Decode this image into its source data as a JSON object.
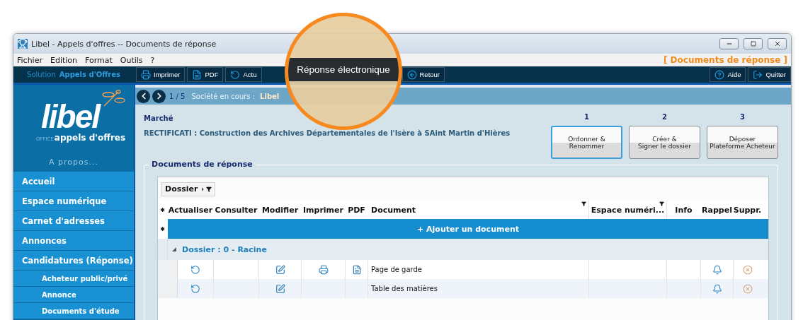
{
  "window": {
    "title": "Libel - Appels d'offres -- Documents de réponse"
  },
  "menu": [
    "Fichier",
    "Edition",
    "Format",
    "Outils",
    "?"
  ],
  "context_label": "[ Documents de réponse ]",
  "toolbar": {
    "solution_label": "Solution",
    "solution_name": "Appels d'Offres",
    "left_buttons": [
      {
        "kind": "print",
        "label": "Imprimer"
      },
      {
        "kind": "pdf",
        "label": "PDF"
      },
      {
        "kind": "refresh",
        "label": "Actu"
      }
    ],
    "middle_buttons": [
      {
        "kind": "back",
        "label": "Retour"
      }
    ],
    "right_buttons": [
      {
        "kind": "help",
        "label": "Aide"
      },
      {
        "kind": "quit",
        "label": "Quitter"
      }
    ]
  },
  "callout": "Réponse électronique",
  "logo": {
    "word": "libel",
    "office": "OFFICE",
    "product": "appels d'offres"
  },
  "about": "A propos...",
  "sidebar": [
    {
      "kind": "main",
      "label": "Accueil"
    },
    {
      "kind": "main",
      "label": "Espace numérique"
    },
    {
      "kind": "main",
      "label": "Carnet d'adresses"
    },
    {
      "kind": "main",
      "label": "Annonces"
    },
    {
      "kind": "main",
      "label": "Candidatures  (Réponse)"
    },
    {
      "kind": "sub",
      "label": "Acheteur public/privé"
    },
    {
      "kind": "sub",
      "label": "Annonce"
    },
    {
      "kind": "sub",
      "label": "Documents d'étude"
    }
  ],
  "nav": {
    "page": "1 / 5",
    "company_label": "Société en cours :",
    "company": "Libel"
  },
  "market": {
    "label": "Marché",
    "title": "RECTIFICATI : Construction des Archives Départementales de l'Isère à SAint Martin d'Hières"
  },
  "steps": [
    {
      "number": "1",
      "lines": [
        "Ordonner &",
        "Renommer"
      ],
      "selected": true
    },
    {
      "number": "2",
      "lines": [
        "Créer &",
        "Signer le dossier"
      ],
      "selected": false
    },
    {
      "number": "3",
      "lines": [
        "Déposer",
        "Plateforme Acheteur"
      ],
      "selected": false
    }
  ],
  "section_title": "Documents de réponse",
  "group_chip": "Dossier",
  "table": {
    "columns": [
      {
        "label": "✱",
        "filter": false
      },
      {
        "label": "Actualiser",
        "filter": false
      },
      {
        "label": "Consulter",
        "filter": false
      },
      {
        "label": "Modifier",
        "filter": false
      },
      {
        "label": "Imprimer",
        "filter": false
      },
      {
        "label": "PDF",
        "filter": false
      },
      {
        "label": "Document",
        "filter": true
      },
      {
        "label": "Espace numéri...",
        "filter": true
      },
      {
        "label": "Info",
        "filter": false
      },
      {
        "label": "Rappel",
        "filter": false
      },
      {
        "label": "Suppr.",
        "filter": false
      }
    ],
    "new_row_marker": "✱",
    "add_label": "+ Ajouter un document",
    "groups": [
      {
        "label": "Dossier : 0 - Racine",
        "expanded": true,
        "rows": [
          {
            "document": "Page de garde",
            "print": true,
            "pdf": true
          },
          {
            "document": "Table des matières",
            "print": false,
            "pdf": false
          }
        ]
      }
    ]
  }
}
